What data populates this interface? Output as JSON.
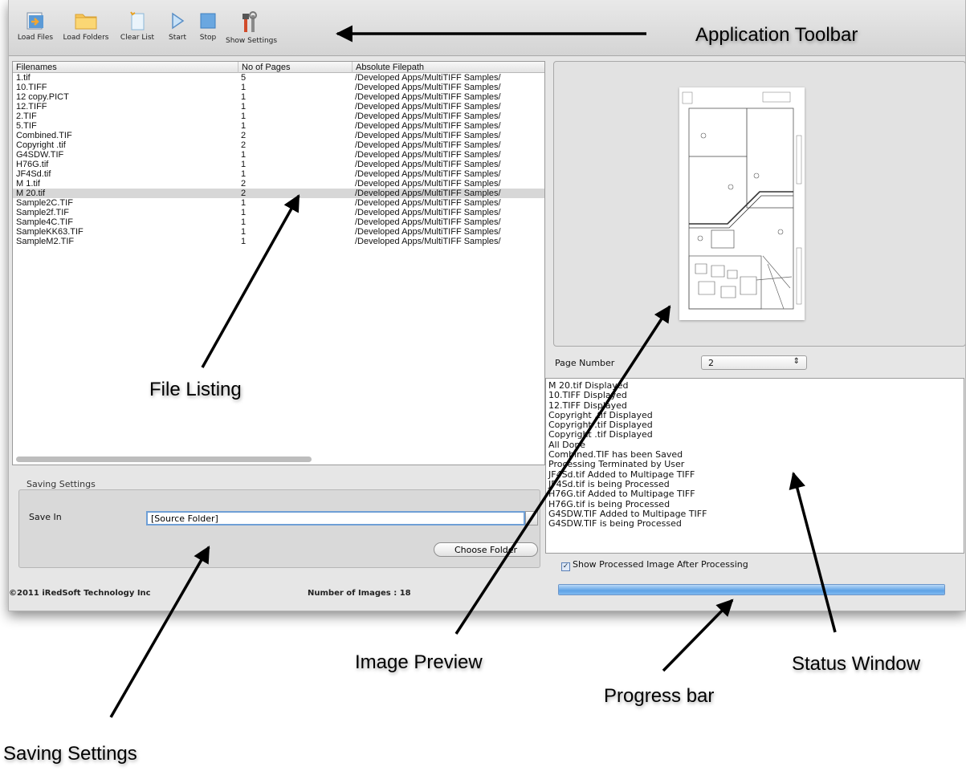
{
  "toolbar": {
    "load_files": "Load Files",
    "load_folders": "Load Folders",
    "clear_list": "Clear List",
    "start": "Start",
    "stop": "Stop",
    "show_settings": "Show Settings"
  },
  "file_list": {
    "columns": [
      "Filenames",
      "No of Pages",
      "Absolute Filepath"
    ],
    "rows": [
      {
        "name": "1.tif",
        "pages": "5",
        "path": "/Developed Apps/MultiTIFF Samples/"
      },
      {
        "name": "10.TIFF",
        "pages": "1",
        "path": "/Developed Apps/MultiTIFF Samples/"
      },
      {
        "name": "12 copy.PICT",
        "pages": "1",
        "path": "/Developed Apps/MultiTIFF Samples/"
      },
      {
        "name": "12.TIFF",
        "pages": "1",
        "path": "/Developed Apps/MultiTIFF Samples/"
      },
      {
        "name": "2.TIF",
        "pages": "1",
        "path": "/Developed Apps/MultiTIFF Samples/"
      },
      {
        "name": "5.TIF",
        "pages": "1",
        "path": "/Developed Apps/MultiTIFF Samples/"
      },
      {
        "name": "Combined.TIF",
        "pages": "2",
        "path": "/Developed Apps/MultiTIFF Samples/"
      },
      {
        "name": "Copyright .tif",
        "pages": "2",
        "path": "/Developed Apps/MultiTIFF Samples/"
      },
      {
        "name": "G4SDW.TIF",
        "pages": "1",
        "path": "/Developed Apps/MultiTIFF Samples/"
      },
      {
        "name": "H76G.tif",
        "pages": "1",
        "path": "/Developed Apps/MultiTIFF Samples/"
      },
      {
        "name": "JF4Sd.tif",
        "pages": "1",
        "path": "/Developed Apps/MultiTIFF Samples/"
      },
      {
        "name": "M 1.tif",
        "pages": "2",
        "path": "/Developed Apps/MultiTIFF Samples/"
      },
      {
        "name": "M 20.tif",
        "pages": "2",
        "path": "/Developed Apps/MultiTIFF Samples/"
      },
      {
        "name": "Sample2C.TIF",
        "pages": "1",
        "path": "/Developed Apps/MultiTIFF Samples/"
      },
      {
        "name": "Sample2f.TIF",
        "pages": "1",
        "path": "/Developed Apps/MultiTIFF Samples/"
      },
      {
        "name": "Sample4C.TIF",
        "pages": "1",
        "path": "/Developed Apps/MultiTIFF Samples/"
      },
      {
        "name": "SampleKK63.TIF",
        "pages": "1",
        "path": "/Developed Apps/MultiTIFF Samples/"
      },
      {
        "name": "SampleM2.TIF",
        "pages": "1",
        "path": "/Developed Apps/MultiTIFF Samples/"
      }
    ],
    "selected_row": 12
  },
  "saving": {
    "title": "Saving Settings",
    "save_in_label": "Save In",
    "save_in_value": "[Source Folder]",
    "choose_folder": "Choose Folder"
  },
  "footer": {
    "copyright": "©2011 iRedSoft Technology Inc",
    "image_count": "Number of Images : 18"
  },
  "preview": {
    "page_number_label": "Page Number",
    "page_number_value": "2"
  },
  "status_lines": [
    "M 20.tif Displayed",
    "10.TIFF Displayed",
    "12.TIFF Displayed",
    "Copyright .tif Displayed",
    "Copyright .tif Displayed",
    "Copyright .tif Displayed",
    "All Done",
    "Combined.TIF has been Saved",
    "Processing Terminated by User",
    "JF4Sd.tif Added to Multipage TIFF",
    "JF4Sd.tif is being Processed",
    "H76G.tif Added to Multipage TIFF",
    "H76G.tif is being Processed",
    "G4SDW.TIF Added to Multipage TIFF",
    "G4SDW.TIF is being Processed"
  ],
  "show_processed": {
    "label": "Show Processed Image After Processing",
    "checked": true
  },
  "progress": {
    "fraction": 1.0
  },
  "annotations": {
    "toolbar": "Application Toolbar",
    "file_listing": "File Listing",
    "image_preview": "Image Preview",
    "status_window": "Status Window",
    "progress_bar": "Progress bar",
    "saving_settings": "Saving Settings"
  },
  "colors": {
    "accent_blue": "#5ea2e6",
    "selection": "#d7d7d7"
  }
}
